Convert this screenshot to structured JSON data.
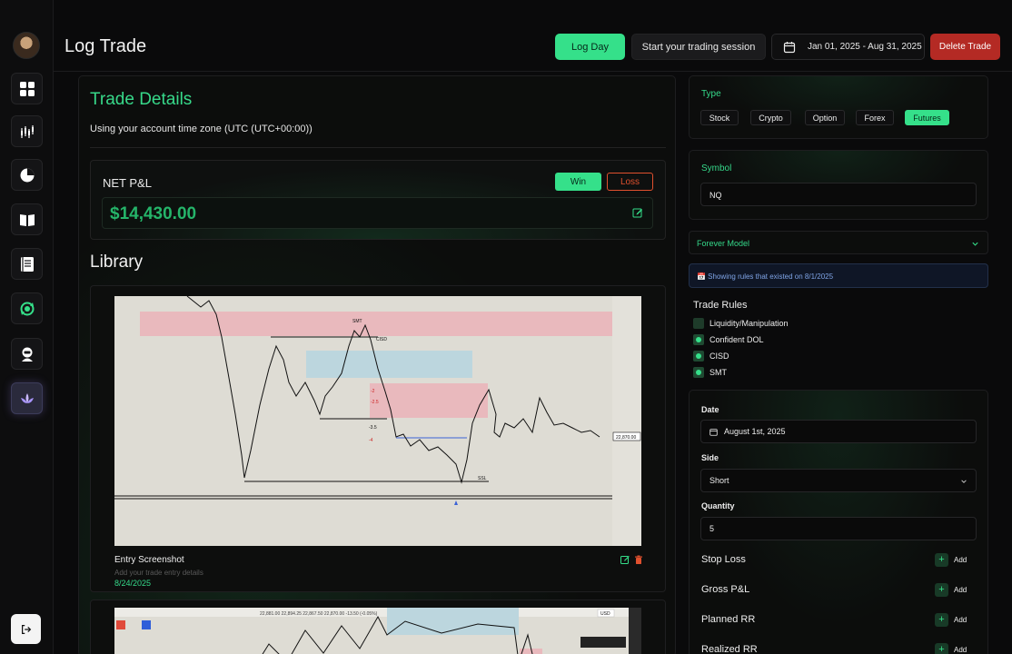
{
  "header": {
    "title": "Log Trade",
    "log_day": "Log Day",
    "start_session": "Start your trading session",
    "date_range": "Jan 01, 2025 - Aug 31, 2025",
    "delete_trade": "Delete Trade"
  },
  "sidebar": {
    "items": [
      {
        "icon": "dashboard-grid-icon"
      },
      {
        "icon": "candlestick-chart-icon"
      },
      {
        "icon": "pie-chart-icon"
      },
      {
        "icon": "book-icon"
      },
      {
        "icon": "notebook-icon"
      },
      {
        "icon": "sync-cycle-icon"
      },
      {
        "icon": "robot-icon"
      },
      {
        "icon": "lotus-icon"
      }
    ],
    "logout_icon": "logout-icon"
  },
  "trade_details": {
    "title": "Trade Details",
    "timezone_note": "Using your account time zone (UTC (UTC+00:00))",
    "net_pnl_label": "NET P&L",
    "win_label": "Win",
    "loss_label": "Loss",
    "net_pnl_value": "$14,430.00"
  },
  "library": {
    "title": "Library",
    "items": [
      {
        "caption": "Entry Screenshot",
        "description_placeholder": "Add your trade entry details",
        "date": "8/24/2025",
        "chart_labels": {
          "smt": "SMT",
          "cisd": "CISD",
          "ssl": "SSL",
          "level_1": "-3.5",
          "level_2": "-4",
          "level_3": "-2",
          "level_4": "-2.5",
          "price_tag": "22,870.00"
        }
      },
      {
        "toolbar_text": "22,881.00   22,894.25   22,867.50   22,870.00   -13.50 (-0.05%)",
        "currency": "USD"
      }
    ]
  },
  "type_card": {
    "label": "Type",
    "options": [
      "Stock",
      "Crypto",
      "Option",
      "Forex",
      "Futures"
    ],
    "selected": "Futures"
  },
  "symbol_card": {
    "label": "Symbol",
    "value": "NQ"
  },
  "model": {
    "selected": "Forever Model"
  },
  "rules_notice": "📅 Showing rules that existed on 8/1/2025",
  "trade_rules": {
    "title": "Trade Rules",
    "items": [
      {
        "label": "Liquidity/Manipulation",
        "checked": false
      },
      {
        "label": "Confident DOL",
        "checked": true
      },
      {
        "label": "CISD",
        "checked": true
      },
      {
        "label": "SMT",
        "checked": true
      }
    ]
  },
  "details": {
    "date_label": "Date",
    "date_value": "August 1st, 2025",
    "side_label": "Side",
    "side_value": "Short",
    "quantity_label": "Quantity",
    "quantity_value": "5",
    "add_rows": [
      "Stop Loss",
      "Gross P&L",
      "Planned RR",
      "Realized RR"
    ],
    "add_label": "Add"
  },
  "colors": {
    "accent_green": "#35e08a",
    "pnl_green": "#25b56a",
    "delete_red": "#b42a24",
    "loss_orange": "#e0502e"
  }
}
